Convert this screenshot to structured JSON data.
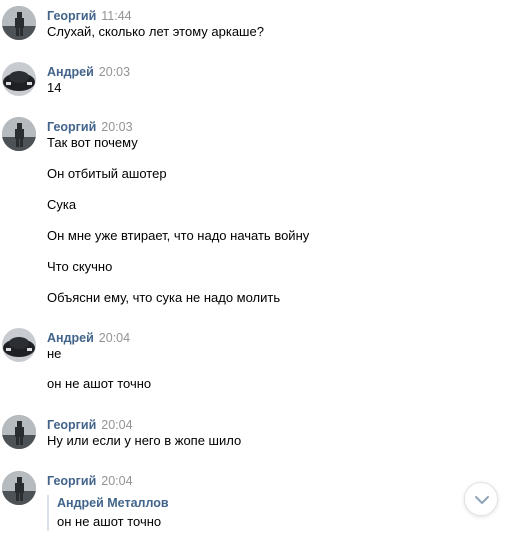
{
  "messages": [
    {
      "author": "Георгий",
      "time": "11:44",
      "avatar": "georgiy-avatar",
      "lines": [
        "Слухай, сколько лет этому аркаше?"
      ]
    },
    {
      "author": "Андрей",
      "time": "20:03",
      "avatar": "andrey-avatar",
      "lines": [
        "14"
      ]
    },
    {
      "author": "Георгий",
      "time": "20:03",
      "avatar": "georgiy-avatar",
      "lines": [
        "Так вот почему",
        "Он отбитый ашотер",
        "Сука",
        "Он мне уже втирает, что надо начать войну",
        "Что скучно",
        "Объясни ему, что сука не надо молить"
      ]
    },
    {
      "author": "Андрей",
      "time": "20:04",
      "avatar": "andrey-avatar",
      "lines": [
        "не",
        "он не ашот точно"
      ]
    },
    {
      "author": "Георгий",
      "time": "20:04",
      "avatar": "georgiy-avatar",
      "lines": [
        "Ну или если у него в жопе шило"
      ]
    },
    {
      "author": "Георгий",
      "time": "20:04",
      "avatar": "georgiy-avatar",
      "lines": [],
      "reply": {
        "author": "Андрей Металлов",
        "text": "он не ашот точно"
      }
    }
  ],
  "scroll_button": {
    "icon": "chevron-down-icon"
  },
  "colors": {
    "author": "#42648b",
    "time": "#939393",
    "text": "#000000",
    "quote_border": "#dae1e8"
  }
}
